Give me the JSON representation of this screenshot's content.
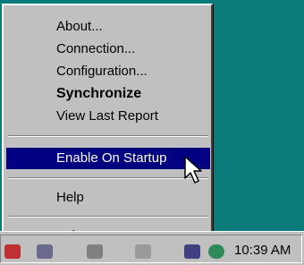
{
  "menu": {
    "items": [
      {
        "label": "About...",
        "bold": false,
        "highlighted": false
      },
      {
        "label": "Connection...",
        "bold": false,
        "highlighted": false
      },
      {
        "label": "Configuration...",
        "bold": false,
        "highlighted": false
      },
      {
        "label": "Synchronize",
        "bold": true,
        "highlighted": false
      },
      {
        "label": "View Last Report",
        "bold": false,
        "highlighted": false
      },
      {
        "label": "Enable On Startup",
        "bold": false,
        "highlighted": true
      },
      {
        "label": "Help",
        "bold": false,
        "highlighted": false
      },
      {
        "label": "Exit",
        "bold": false,
        "highlighted": false
      }
    ]
  },
  "taskbar": {
    "clock": "10:39 AM",
    "tray_icons": [
      "app-tray-icon",
      "monitor-tray-icon",
      "network-tray-icon",
      "speaker-tray-icon",
      "sync-tray-icon",
      "globe-tray-icon"
    ]
  },
  "colors": {
    "desktop": "#0a7b7b",
    "menu_bg": "#c0c0c0",
    "highlight": "#000080"
  }
}
